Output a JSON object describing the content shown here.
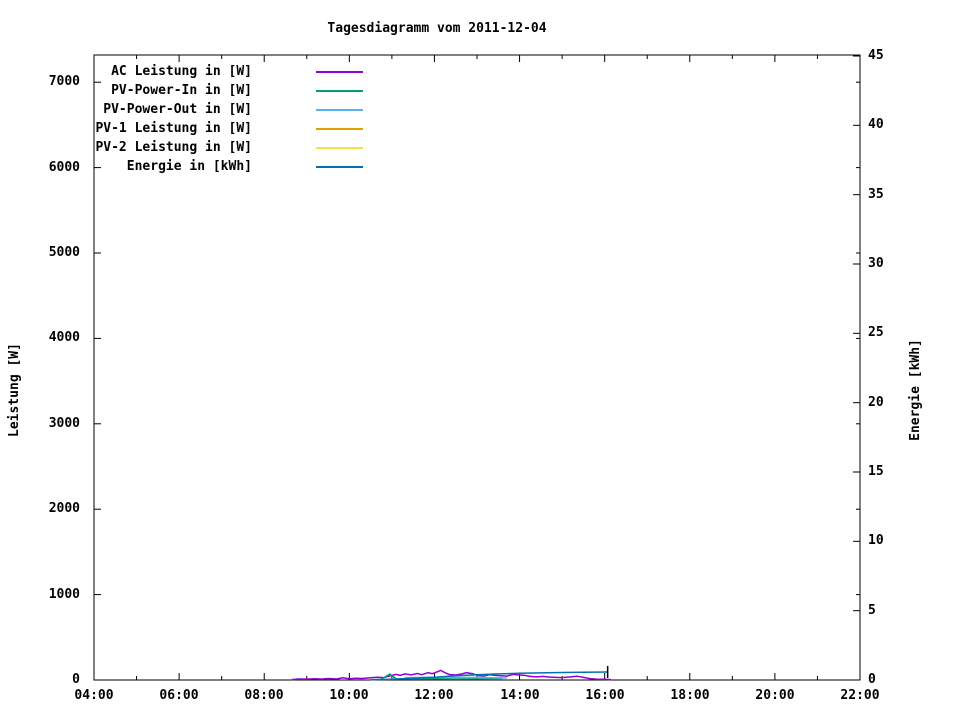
{
  "title": "Tagesdiagramm vom 2011-12-04",
  "chart_data": {
    "type": "line",
    "title": "Tagesdiagramm vom 2011-12-04",
    "xlabel": "",
    "y1label": "Leistung [W]",
    "y2label": "Energie [kWh]",
    "x_axis": {
      "start_hour": 4,
      "end_hour": 22,
      "major_tick_labels": [
        "04:00",
        "06:00",
        "08:00",
        "10:00",
        "12:00",
        "14:00",
        "16:00",
        "18:00",
        "20:00",
        "22:00"
      ],
      "minor_tick_every_hours": 1
    },
    "y1_axis": {
      "lim": [
        0,
        7300
      ],
      "tick_step": 1000,
      "tick_labels": [
        "0",
        "1000",
        "2000",
        "3000",
        "4000",
        "5000",
        "6000",
        "7000"
      ]
    },
    "y2_axis": {
      "lim": [
        0,
        45
      ],
      "tick_step": 5,
      "tick_labels": [
        "0",
        "5",
        "10",
        "15",
        "20",
        "25",
        "30",
        "35",
        "40",
        "45"
      ]
    },
    "grid": false,
    "legend_position": "top-left-inside",
    "series": [
      {
        "name": "AC Leistung in [W]",
        "color": "#9400D3",
        "axis": "y1",
        "points": [
          [
            8.65,
            5
          ],
          [
            8.8,
            12
          ],
          [
            9.0,
            10
          ],
          [
            9.2,
            14
          ],
          [
            9.35,
            10
          ],
          [
            9.5,
            18
          ],
          [
            9.7,
            12
          ],
          [
            9.85,
            26
          ],
          [
            10.0,
            15
          ],
          [
            10.15,
            20
          ],
          [
            10.3,
            18
          ],
          [
            10.5,
            26
          ],
          [
            10.65,
            32
          ],
          [
            10.8,
            28
          ],
          [
            10.95,
            48
          ],
          [
            11.1,
            66
          ],
          [
            11.2,
            55
          ],
          [
            11.3,
            72
          ],
          [
            11.45,
            60
          ],
          [
            11.6,
            76
          ],
          [
            11.7,
            62
          ],
          [
            11.85,
            86
          ],
          [
            11.95,
            74
          ],
          [
            12.05,
            92
          ],
          [
            12.15,
            112
          ],
          [
            12.25,
            84
          ],
          [
            12.35,
            64
          ],
          [
            12.5,
            58
          ],
          [
            12.65,
            72
          ],
          [
            12.75,
            86
          ],
          [
            12.9,
            74
          ],
          [
            13.0,
            55
          ],
          [
            13.15,
            46
          ],
          [
            13.3,
            62
          ],
          [
            13.4,
            56
          ],
          [
            13.55,
            50
          ],
          [
            13.7,
            46
          ],
          [
            13.85,
            66
          ],
          [
            13.95,
            60
          ],
          [
            14.1,
            56
          ],
          [
            14.25,
            42
          ],
          [
            14.4,
            36
          ],
          [
            14.55,
            42
          ],
          [
            14.7,
            34
          ],
          [
            14.85,
            30
          ],
          [
            15.0,
            28
          ],
          [
            15.2,
            36
          ],
          [
            15.35,
            44
          ],
          [
            15.5,
            30
          ],
          [
            15.65,
            16
          ],
          [
            15.8,
            10
          ],
          [
            16.0,
            8
          ],
          [
            16.15,
            5
          ]
        ]
      },
      {
        "name": "PV-Power-In in [W]",
        "color": "#009E73",
        "axis": "y1",
        "points": [
          [
            10.75,
            8
          ],
          [
            10.95,
            70
          ],
          [
            11.1,
            15
          ],
          [
            11.5,
            12
          ],
          [
            12.0,
            14
          ],
          [
            12.5,
            12
          ],
          [
            13.0,
            13
          ],
          [
            13.6,
            8
          ]
        ]
      },
      {
        "name": "PV-Power-Out in [W]",
        "color": "#56B4E9",
        "axis": "y1",
        "points": [
          [
            11.3,
            28
          ],
          [
            11.7,
            30
          ],
          [
            12.1,
            32
          ],
          [
            12.5,
            30
          ],
          [
            12.9,
            30
          ],
          [
            13.3,
            27
          ],
          [
            13.7,
            24
          ]
        ]
      },
      {
        "name": "PV-1 Leistung in [W]",
        "color": "#E0A000",
        "axis": "y1",
        "points": []
      },
      {
        "name": "PV-2 Leistung in [W]",
        "color": "#F0E442",
        "axis": "y1",
        "points": []
      },
      {
        "name": "Energie in [kWh]",
        "color": "#0072B2",
        "axis": "y2",
        "points": [
          [
            10.5,
            0.02
          ],
          [
            11.0,
            0.06
          ],
          [
            11.5,
            0.12
          ],
          [
            12.0,
            0.2
          ],
          [
            12.5,
            0.3
          ],
          [
            13.0,
            0.38
          ],
          [
            13.5,
            0.44
          ],
          [
            14.0,
            0.48
          ],
          [
            14.5,
            0.51
          ],
          [
            15.0,
            0.54
          ],
          [
            15.5,
            0.56
          ],
          [
            16.07,
            0.58
          ]
        ]
      }
    ],
    "end_marker": {
      "hour": 16.07,
      "kwh": 0.58
    }
  }
}
